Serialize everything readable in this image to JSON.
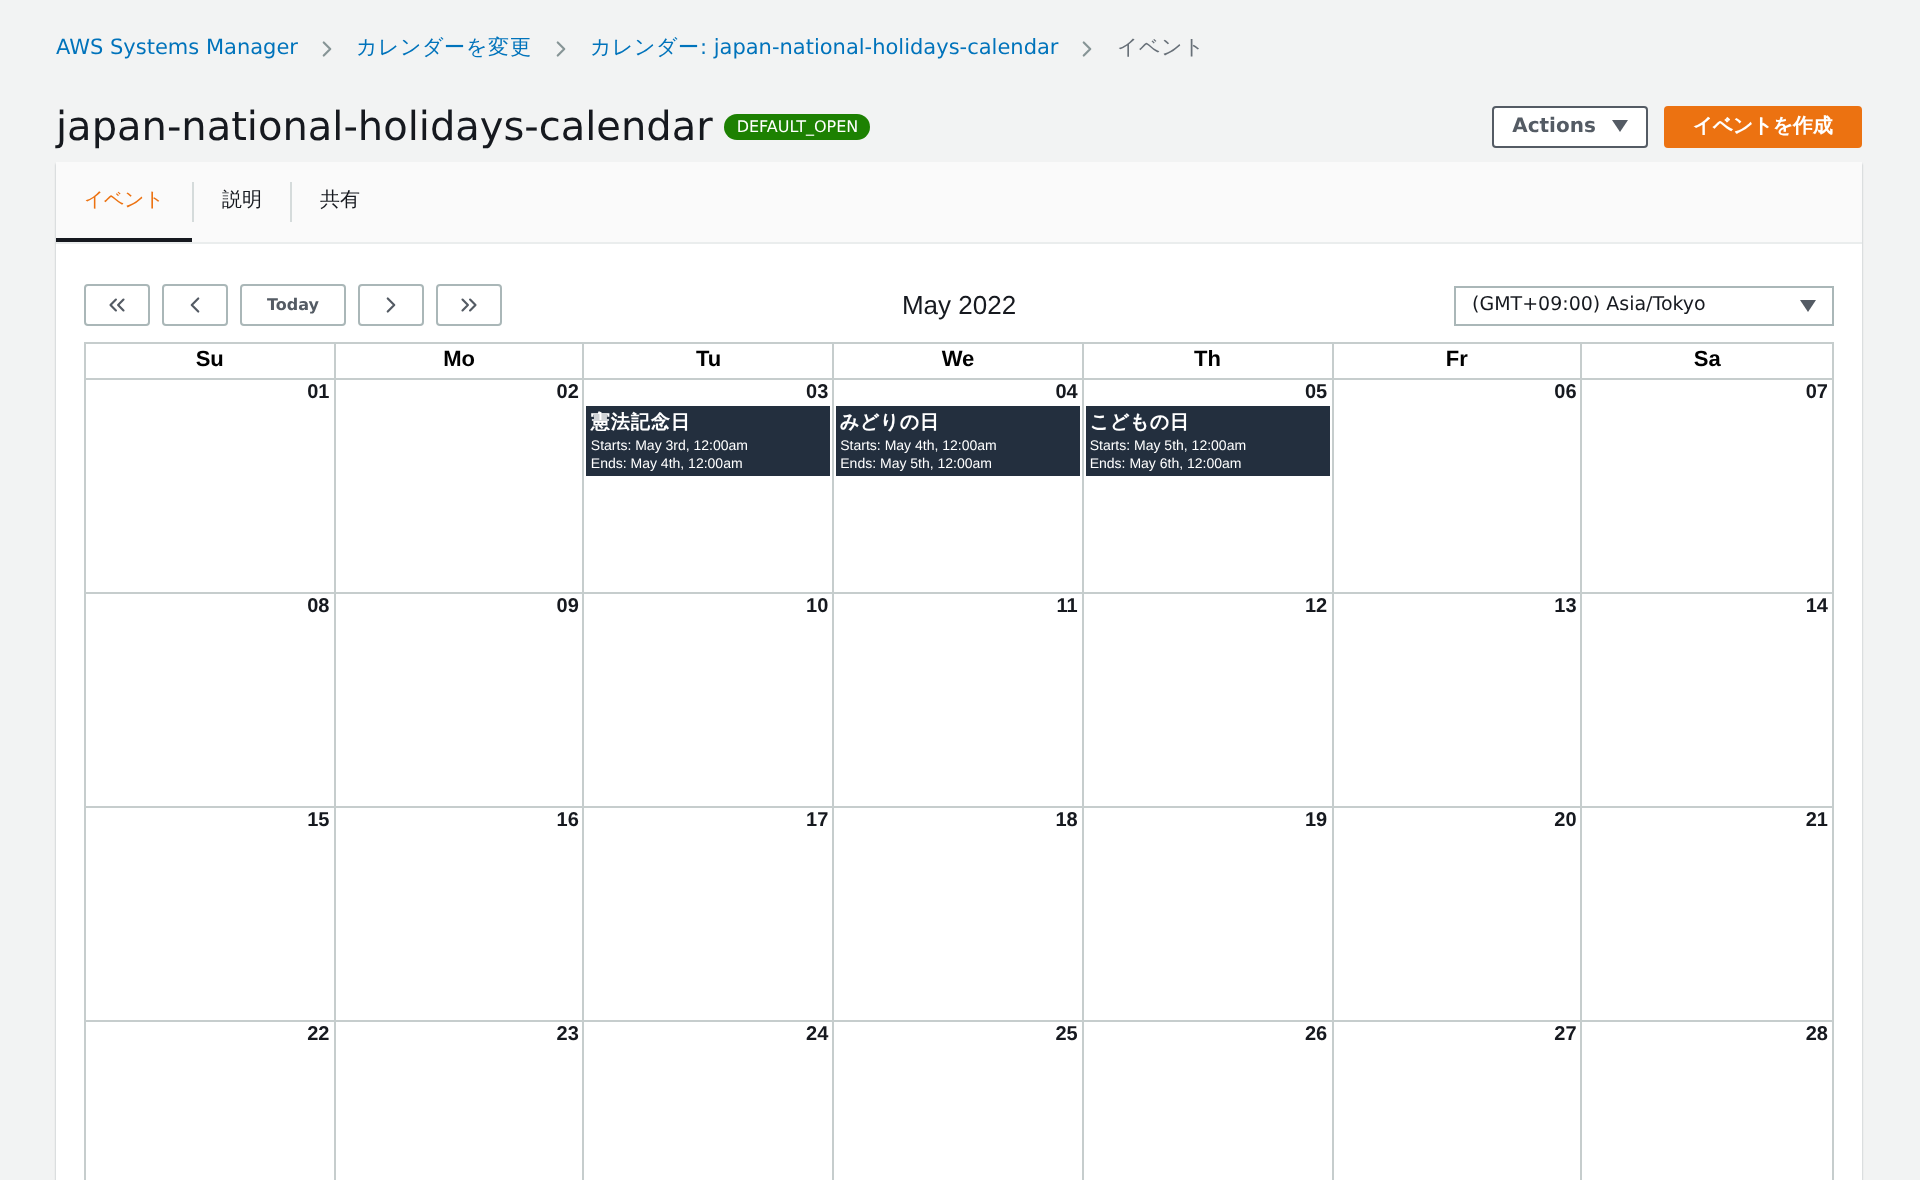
{
  "breadcrumbs": [
    {
      "label": "AWS Systems Manager",
      "link": true
    },
    {
      "label": "カレンダーを変更",
      "link": true
    },
    {
      "label": "カレンダー: japan-national-holidays-calendar",
      "link": true
    },
    {
      "label": "イベント",
      "link": false
    }
  ],
  "title": "japan-national-holidays-calendar",
  "badge": "DEFAULT_OPEN",
  "actions": {
    "label": "Actions"
  },
  "create_button": "イベントを作成",
  "tabs": [
    {
      "label": "イベント",
      "selected": true
    },
    {
      "label": "説明",
      "selected": false
    },
    {
      "label": "共有",
      "selected": false
    }
  ],
  "nav": {
    "today": "Today"
  },
  "month": "May 2022",
  "timezone": "(GMT+09:00) Asia/Tokyo",
  "weekdays": [
    "Su",
    "Mo",
    "Tu",
    "We",
    "Th",
    "Fr",
    "Sa"
  ],
  "weeks": [
    {
      "days": [
        {
          "day": "01"
        },
        {
          "day": "02"
        },
        {
          "day": "03",
          "events": [
            {
              "title": "憲法記念日",
              "starts": "Starts: May 3rd, 12:00am",
              "ends": "Ends: May 4th, 12:00am"
            }
          ]
        },
        {
          "day": "04",
          "events": [
            {
              "title": "みどりの日",
              "starts": "Starts: May 4th, 12:00am",
              "ends": "Ends: May 5th, 12:00am"
            }
          ]
        },
        {
          "day": "05",
          "events": [
            {
              "title": "こどもの日",
              "starts": "Starts: May 5th, 12:00am",
              "ends": "Ends: May 6th, 12:00am"
            }
          ]
        },
        {
          "day": "06"
        },
        {
          "day": "07"
        }
      ]
    },
    {
      "days": [
        {
          "day": "08"
        },
        {
          "day": "09"
        },
        {
          "day": "10"
        },
        {
          "day": "11"
        },
        {
          "day": "12"
        },
        {
          "day": "13"
        },
        {
          "day": "14"
        }
      ]
    },
    {
      "days": [
        {
          "day": "15"
        },
        {
          "day": "16"
        },
        {
          "day": "17"
        },
        {
          "day": "18"
        },
        {
          "day": "19"
        },
        {
          "day": "20"
        },
        {
          "day": "21"
        }
      ]
    },
    {
      "days": [
        {
          "day": "22"
        },
        {
          "day": "23"
        },
        {
          "day": "24"
        },
        {
          "day": "25"
        },
        {
          "day": "26"
        },
        {
          "day": "27"
        },
        {
          "day": "28"
        }
      ]
    }
  ]
}
